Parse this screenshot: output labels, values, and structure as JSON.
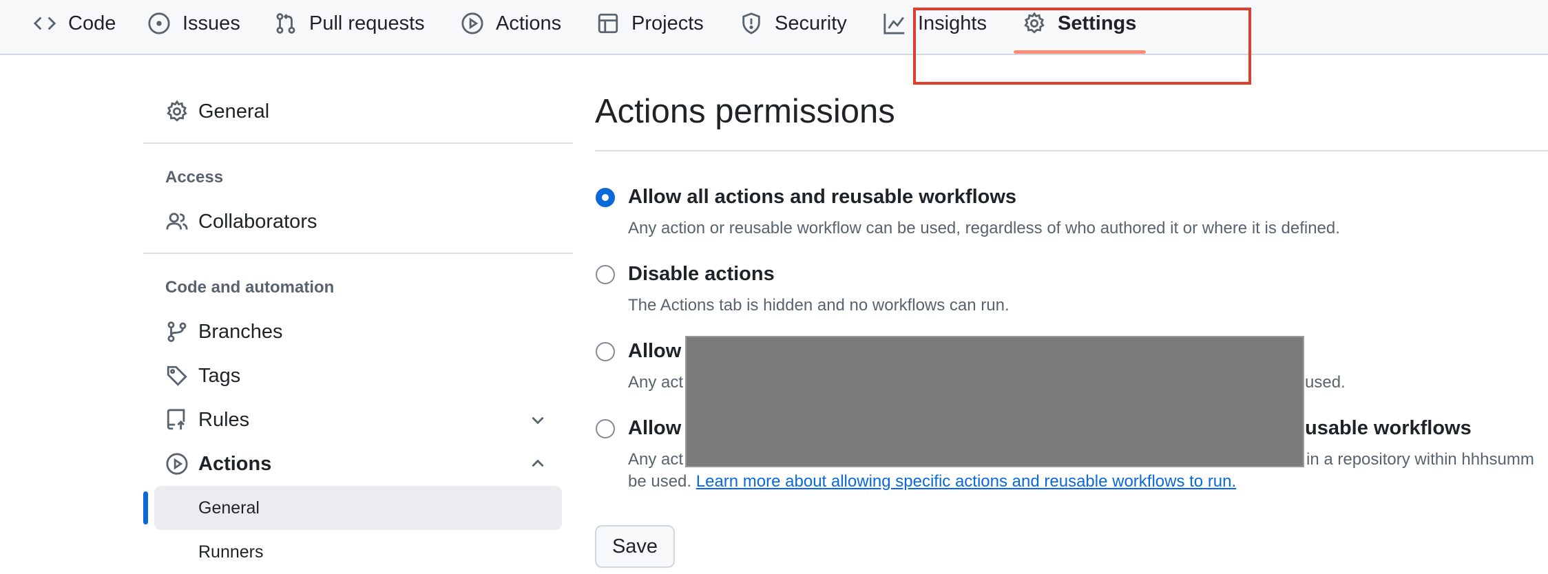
{
  "nav": {
    "tabs": [
      {
        "label": "Code",
        "icon": "code-icon"
      },
      {
        "label": "Issues",
        "icon": "issue-opened-icon"
      },
      {
        "label": "Pull requests",
        "icon": "git-pull-request-icon"
      },
      {
        "label": "Actions",
        "icon": "play-icon"
      },
      {
        "label": "Projects",
        "icon": "table-icon"
      },
      {
        "label": "Security",
        "icon": "shield-icon"
      },
      {
        "label": "Insights",
        "icon": "graph-icon"
      },
      {
        "label": "Settings",
        "icon": "gear-icon",
        "active": true
      }
    ],
    "active_underline_color": "#fd8c73",
    "highlight_box_color": "#e13d2c"
  },
  "sidebar": {
    "general": "General",
    "access_heading": "Access",
    "collaborators": "Collaborators",
    "code_automation_heading": "Code and automation",
    "branches": "Branches",
    "tags": "Tags",
    "rules": "Rules",
    "actions": "Actions",
    "actions_general": "General",
    "runners": "Runners"
  },
  "main": {
    "title": "Actions permissions",
    "options": [
      {
        "label": "Allow all actions and reusable workflows",
        "description": "Any action or reusable workflow can be used, regardless of who authored it or where it is defined.",
        "checked": true
      },
      {
        "label": "Disable actions",
        "description": "The Actions tab is hidden and no workflows can run.",
        "checked": false
      },
      {
        "label_visible_start": "Allow",
        "description_visible_start": "Any act",
        "description_visible_end": "used.",
        "checked": false
      },
      {
        "label_visible_start": "Allow",
        "label_visible_end": "usable workflows",
        "description_visible_start": "Any act",
        "description_visible_end": "in a repository within hhhsumm",
        "description_line2": "be used.",
        "link_text": "Learn more about allowing specific actions and reusable workflows to run.",
        "checked": false
      }
    ],
    "save_label": "Save"
  },
  "colors": {
    "accent": "#0969da",
    "redaction": "#7b7b7b"
  }
}
